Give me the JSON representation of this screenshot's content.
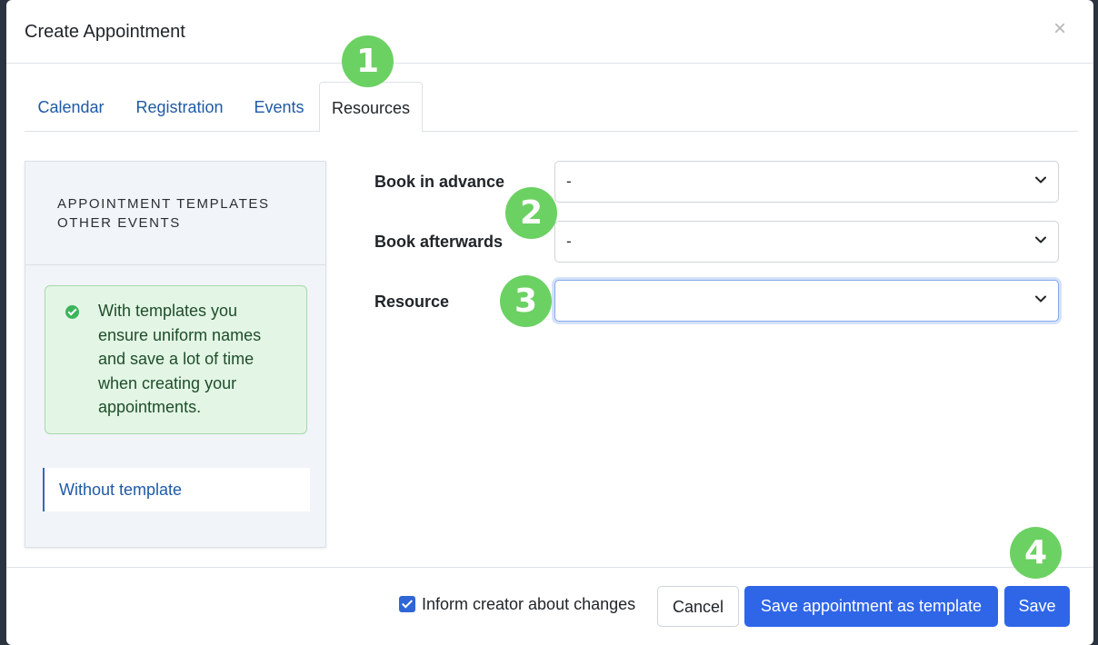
{
  "dialog": {
    "title": "Create Appointment",
    "close_label": "×"
  },
  "tabs": [
    {
      "label": "Calendar"
    },
    {
      "label": "Registration"
    },
    {
      "label": "Events"
    },
    {
      "label": "Resources",
      "active": true
    }
  ],
  "badges": [
    "1",
    "2",
    "3",
    "4"
  ],
  "sidebar": {
    "heading_line1": "APPOINTMENT TEMPLATES",
    "heading_line2": "OTHER EVENTS",
    "info_text": "With templates you ensure uniform names and save a lot of time when creating your appointments.",
    "template_item": "Without template"
  },
  "form": {
    "book_in_advance": {
      "label": "Book in advance",
      "value": "-"
    },
    "book_afterwards": {
      "label": "Book afterwards",
      "value": "-"
    },
    "resource": {
      "label": "Resource",
      "value": ""
    }
  },
  "footer": {
    "inform_checkbox_label": "Inform creator about changes",
    "inform_checked": true,
    "cancel_label": "Cancel",
    "save_template_label": "Save appointment as template",
    "save_label": "Save"
  },
  "colors": {
    "primary": "#2f66e8",
    "link": "#1f5aa6",
    "badge": "#6cd163",
    "alert_bg": "#e3f6e5"
  }
}
